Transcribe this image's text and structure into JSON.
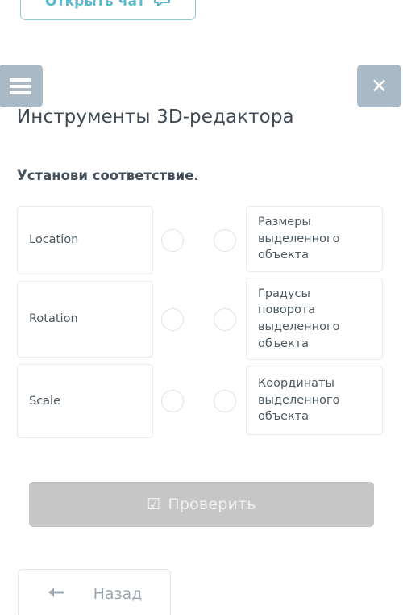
{
  "chat_button": {
    "label": "Открыть чат",
    "icon": "chat-bubble-icon",
    "accent_color": "#5bb8cf",
    "border_color": "#8ec8d6"
  },
  "header": {
    "menu_icon": "hamburger-menu-icon",
    "close_icon": "close-x-icon",
    "icon_button_color": "#a9bac6",
    "title": "Инструменты 3D-редактора"
  },
  "task": {
    "prompt": "Установи соответствие.",
    "rows": [
      {
        "left": "Location",
        "right": "Размеры выделенного объекта",
        "left_dot_selected": false,
        "right_dot_selected": false
      },
      {
        "left": "Rotation",
        "right": "Градусы поворота выделенного объекта",
        "left_dot_selected": false,
        "right_dot_selected": false
      },
      {
        "left": "Scale",
        "right": "Координаты выделенного объекта",
        "left_dot_selected": false,
        "right_dot_selected": false
      }
    ]
  },
  "check_button": {
    "label": "Проверить",
    "icon": "checked-box-icon",
    "glyph": "☑",
    "disabled": true,
    "background_color": "#c6c6c6",
    "text_color": "#f0f0f0"
  },
  "back_button": {
    "label": "Назад",
    "icon": "arrow-left-icon",
    "text_color": "#9aa7b3",
    "border_color": "#e3e6e8"
  }
}
